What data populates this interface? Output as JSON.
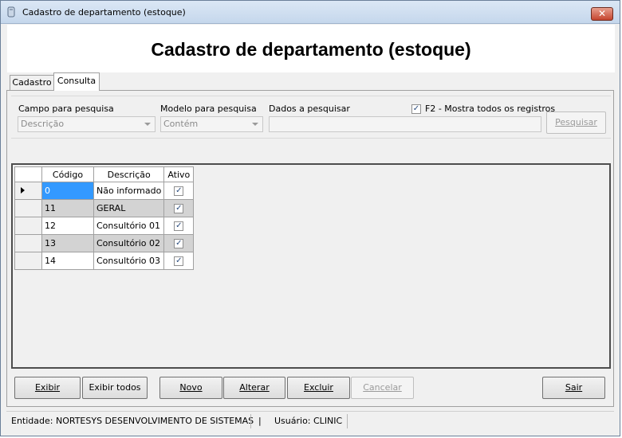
{
  "window": {
    "title": "Cadastro de departamento (estoque)",
    "close_label": "✕"
  },
  "header": {
    "title": "Cadastro de departamento (estoque)"
  },
  "tabs": [
    {
      "label": "Cadastro"
    },
    {
      "label": "Consulta"
    }
  ],
  "search": {
    "campo_label": "Campo para pesquisa",
    "campo_value": "Descrição",
    "modelo_label": "Modelo para pesquisa",
    "modelo_value": "Contém",
    "dados_label": "Dados a pesquisar",
    "dados_value": "",
    "f2_label": "F2 - Mostra todos os registros",
    "f2_checked": true,
    "pesquisar_label": "Pesquisar"
  },
  "grid": {
    "columns": [
      "Código",
      "Descrição",
      "Ativo"
    ],
    "rows": [
      {
        "codigo": "0",
        "descricao": "Não informado",
        "ativo": true
      },
      {
        "codigo": "11",
        "descricao": "GERAL",
        "ativo": true
      },
      {
        "codigo": "12",
        "descricao": "Consultório 01",
        "ativo": true
      },
      {
        "codigo": "13",
        "descricao": "Consultório 02",
        "ativo": true
      },
      {
        "codigo": "14",
        "descricao": "Consultório 03",
        "ativo": true
      }
    ]
  },
  "buttons": {
    "exibir": "Exibir",
    "exibir_todos": "Exibir todos",
    "novo": "Novo",
    "alterar": "Alterar",
    "excluir": "Excluir",
    "cancelar": "Cancelar",
    "sair": "Sair"
  },
  "status": {
    "entidade": "Entidade: NORTESYS DESENVOLVIMENTO DE SISTEMAS",
    "divider": "|",
    "usuario": "Usuário: CLINIC"
  },
  "colors": {
    "selection": "#3399ff",
    "alt_row": "#d3d3d3"
  }
}
